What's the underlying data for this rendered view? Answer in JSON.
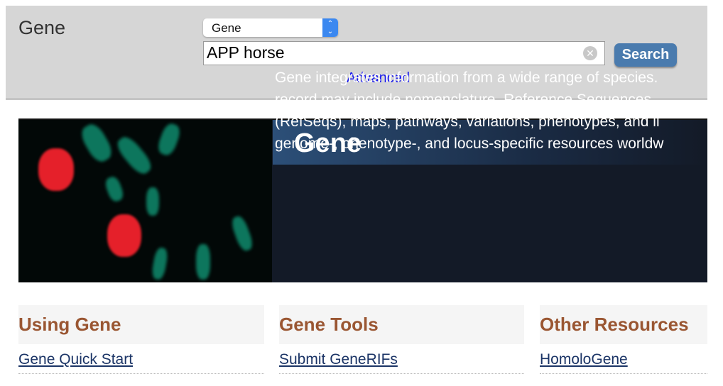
{
  "header": {
    "db_title": "Gene",
    "db_select": "Gene",
    "search_value": "APP horse",
    "search_button": "Search",
    "advanced_link": "Advanced"
  },
  "banner": {
    "title": "Gene",
    "description_lines": [
      "Gene integrates information from a wide range of species.",
      "record may include nomenclature, Reference Sequences",
      "(RefSeqs), maps, pathways, variations, phenotypes, and li",
      "genome-, phenotype-, and locus-specific resources worldw"
    ]
  },
  "columns": [
    {
      "heading": "Using Gene",
      "link": "Gene Quick Start"
    },
    {
      "heading": "Gene Tools",
      "link": "Submit GeneRIFs"
    },
    {
      "heading": "Other Resources",
      "link": "HomoloGene"
    }
  ],
  "colors": {
    "heading": "#9a5632",
    "link": "#1b3466",
    "search_button": "#4a7bae"
  }
}
